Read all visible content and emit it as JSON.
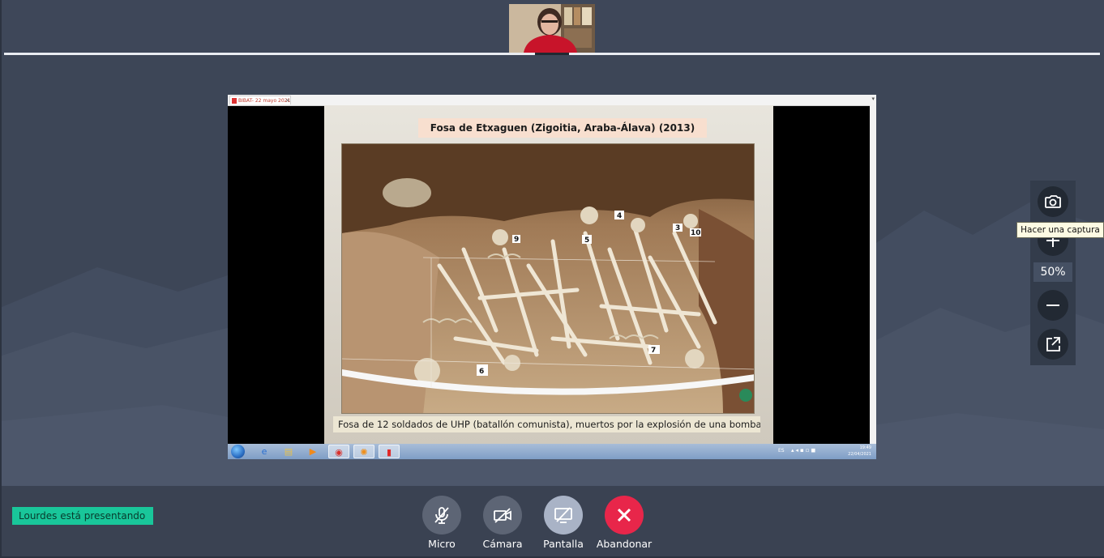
{
  "meeting": {
    "presenter_status": "Lourdes está presentando",
    "zoom_level": "50%",
    "tooltip": "Hacer una captura",
    "controls": [
      {
        "label": "Micro",
        "icon": "mic-off-icon"
      },
      {
        "label": "Cámara",
        "icon": "camera-off-icon"
      },
      {
        "label": "Pantalla",
        "icon": "screen-share-off-icon"
      },
      {
        "label": "Abandonar",
        "icon": "close-icon"
      }
    ],
    "zoom_tools": [
      "camera-snapshot-icon",
      "plus-icon",
      "minus-icon",
      "pop-out-icon"
    ]
  },
  "shared_screen": {
    "tab_title": "BIBAT- 22 mayo 2021",
    "slide_title": "Fosa de Etxaguen (Zigoitia, Araba-Álava) (2013)",
    "slide_caption": "Fosa de 12 soldados de UHP (batallón comunista), muertos por la explosión de una bomba.",
    "photo_labels": [
      "4",
      "5",
      "3",
      "10",
      "9",
      "6",
      "7"
    ],
    "taskbar": {
      "lang": "ES",
      "time": "19:49",
      "date": "22/04/2021",
      "apps": [
        "internet-explorer-icon",
        "file-explorer-icon",
        "media-player-icon",
        "chrome-icon",
        "app-icon",
        "pdf-reader-icon"
      ]
    }
  },
  "colors": {
    "background": "#3d4657",
    "panel": "#333c4b",
    "presenter_badge": "#19c69a",
    "leave_button": "#e8264a",
    "share_button": "#a9b3c6",
    "control_button": "#5d6575"
  }
}
